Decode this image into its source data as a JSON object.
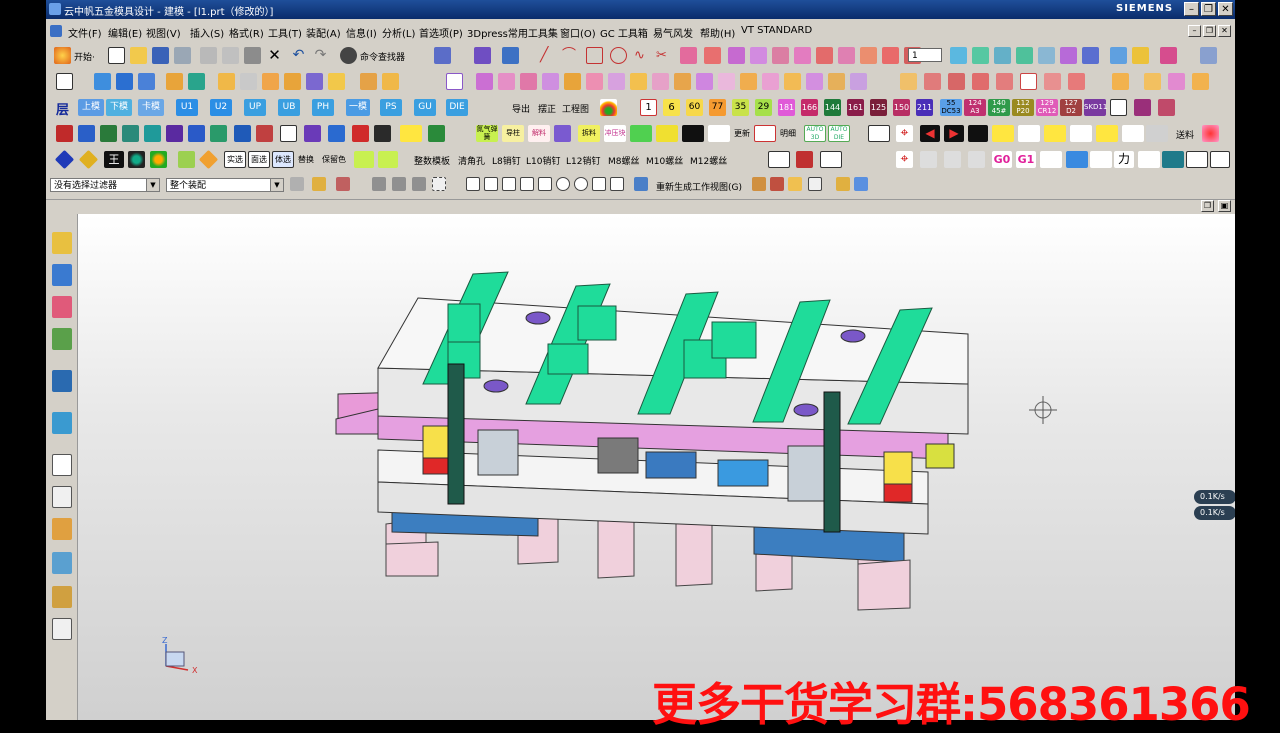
{
  "window": {
    "title": "云中帆五金模具设计 - 建模 - [l1.prt（修改的）]",
    "brand": "SIEMENS"
  },
  "menu": [
    "文件(F)",
    "编辑(E)",
    "视图(V)",
    "插入(S)",
    "格式(R)",
    "工具(T)",
    "装配(A)",
    "信息(I)",
    "分析(L)",
    "首选项(P)",
    "3Dpress常用工具集",
    "窗口(O)",
    "GC 工具箱",
    "易气风发",
    "帮助(H)",
    "VT STANDARD"
  ],
  "toolbar1": {
    "start": "开始·",
    "command_finder": "命令查找器",
    "layer_value": "1"
  },
  "toolbar3": {
    "labels": [
      "层",
      "上模",
      "下模",
      "卡模",
      "U1",
      "U2",
      "UP",
      "UB",
      "PH",
      "一模",
      "PS",
      "GU",
      "DIE"
    ],
    "export": "导出",
    "trim": "摆正",
    "drawing": "工程图"
  },
  "toolbar3_numbers": [
    "1",
    "6",
    "60",
    "77",
    "35",
    "29",
    "181",
    "166",
    "144",
    "161",
    "125",
    "150",
    "211",
    "55",
    "124",
    "140",
    "112",
    "129",
    "127"
  ],
  "toolbar3_small": [
    "DC53",
    "A3",
    "45#",
    "P20",
    "CR12",
    "D2",
    "SKD11"
  ],
  "toolbar4": {
    "labels": [
      "氮气弹簧",
      "导柱",
      "解料",
      "拆料",
      "冲压块",
      "更新",
      "明细",
      "AUTO 3D",
      "AUTO DIE",
      "送料"
    ]
  },
  "toolbar5": {
    "labels": [
      "王",
      "实选",
      "面选",
      "体选",
      "替换",
      "保留色",
      "整数模板",
      "清角孔",
      "L8销钉",
      "L10销钉",
      "L12销钉",
      "M8螺丝",
      "M10螺丝",
      "M12螺丝",
      "G0",
      "G1",
      "力"
    ]
  },
  "filter": {
    "type_filter": "没有选择过滤器",
    "scope": "整个装配",
    "regenerate": "重新生成工作视图(G)"
  },
  "viewport": {
    "speed_up": "0.1K/s",
    "speed_down": "0.1K/s",
    "triad_z": "Z",
    "triad_x": "X"
  },
  "overlay": {
    "promo": "更多干货学习群:568361366"
  },
  "colors": {
    "title_bg": "#0a2c6b",
    "die_green": "#1fdc9a",
    "plate_white": "#f2f2f2",
    "pink": "#e89ad8",
    "blue": "#2a7ac0",
    "promo_red": "#ff1010"
  }
}
